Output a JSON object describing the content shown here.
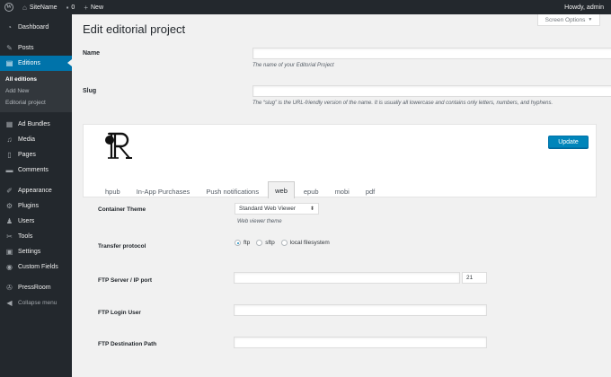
{
  "admin_bar": {
    "site_name": "SiteName",
    "comments_count": "0",
    "new_label": "New",
    "greeting": "Howdy, admin"
  },
  "sidebar": {
    "items": [
      {
        "label": "Dashboard",
        "icon": "dashboard-icon"
      },
      {
        "label": "Posts",
        "icon": "pushpin-icon"
      },
      {
        "label": "Editions",
        "icon": "editions-icon"
      },
      {
        "label": "Ad Bundles",
        "icon": "ad-bundles-icon"
      },
      {
        "label": "Media",
        "icon": "media-icon"
      },
      {
        "label": "Pages",
        "icon": "pages-icon"
      },
      {
        "label": "Comments",
        "icon": "comments-icon"
      },
      {
        "label": "Appearance",
        "icon": "appearance-icon"
      },
      {
        "label": "Plugins",
        "icon": "plugins-icon"
      },
      {
        "label": "Users",
        "icon": "users-icon"
      },
      {
        "label": "Tools",
        "icon": "tools-icon"
      },
      {
        "label": "Settings",
        "icon": "settings-icon"
      },
      {
        "label": "Custom Fields",
        "icon": "custom-fields-icon"
      },
      {
        "label": "PressRoom",
        "icon": "pressroom-icon"
      }
    ],
    "submenu": [
      "All editions",
      "Add New",
      "Editorial project"
    ],
    "collapse_label": "Collapse menu"
  },
  "page": {
    "screen_options": "Screen Options",
    "title": "Edit editorial project",
    "name_label": "Name",
    "name_value": "",
    "name_desc": "The name of your Editorial Project",
    "slug_label": "Slug",
    "slug_value": "",
    "slug_desc": "The “slug” is the URL-friendly version of the name. It is usually all lowercase and contains only letters, numbers, and hyphens."
  },
  "panel": {
    "update_label": "Update",
    "tabs": [
      "hpub",
      "In-App Purchases",
      "Push notifications",
      "web",
      "epub",
      "mobi",
      "pdf"
    ],
    "active_tab": "web"
  },
  "settings": {
    "container_theme_label": "Container Theme",
    "container_theme_value": "Standard Web Viewer",
    "container_theme_desc": "Web viewer theme",
    "transfer_label": "Transfer protocol",
    "transfer_options": [
      "ftp",
      "sftp",
      "local filesystem"
    ],
    "transfer_selected": "ftp",
    "ftp_server_label": "FTP Server / IP port",
    "ftp_server_value": "",
    "ftp_port_value": "21",
    "ftp_user_label": "FTP Login User",
    "ftp_user_value": "",
    "ftp_path_label": "FTP Destination Path",
    "ftp_path_value": ""
  },
  "colors": {
    "admin_bar": "#23282d",
    "accent": "#0073aa",
    "button": "#0085ba",
    "background": "#f1f1f1"
  }
}
